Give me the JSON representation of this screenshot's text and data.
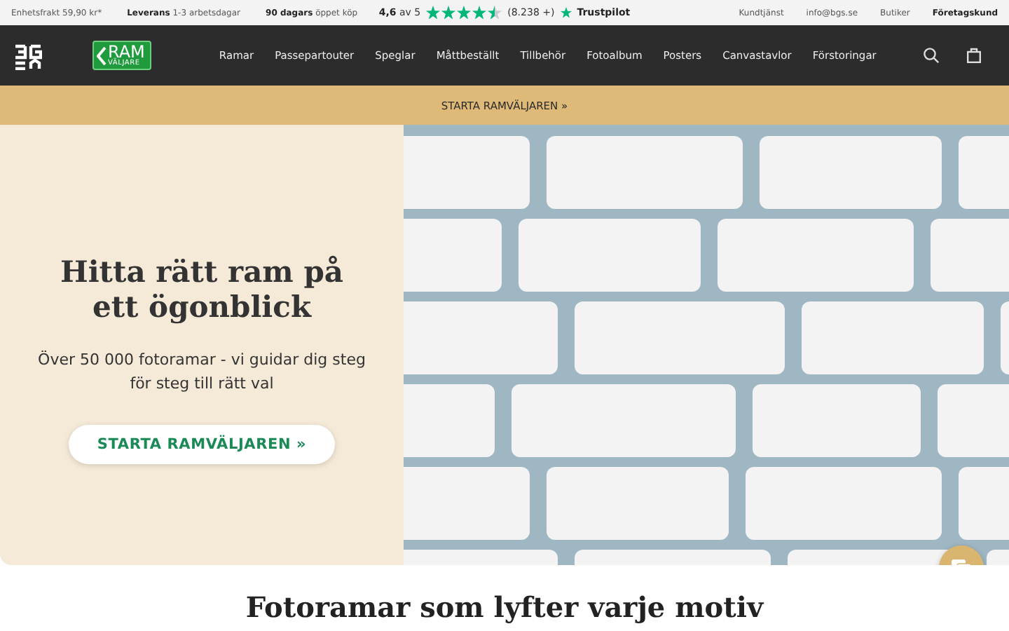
{
  "top_bar": {
    "left": [
      "Enhetsfrakt 59,90 kr*",
      "**Leverans** 1-3 arbetsdagar",
      "**90 dagars** öppet köp"
    ],
    "rating": {
      "score": "**4,6** av 5",
      "stars": 4.5,
      "count": "(8.238 +)",
      "brand": "Trustpilot"
    },
    "right": [
      {
        "label": "Kundtjänst",
        "bold": false
      },
      {
        "label": "info@bgs.se",
        "bold": false
      },
      {
        "label": "Butiker",
        "bold": false
      },
      {
        "label": "Företagskund",
        "bold": true
      }
    ]
  },
  "nav": {
    "badge": {
      "line1": "RAM",
      "line2": "VÄLJARE"
    },
    "items": [
      "Ramar",
      "Passepartouter",
      "Speglar",
      "Måttbeställt",
      "Tillbehör",
      "Fotoalbum",
      "Posters",
      "Canvastavlor",
      "Förstoringar"
    ]
  },
  "banner": {
    "label": "STARTA RAMVÄLJAREN »"
  },
  "hero": {
    "title": "Hitta rätt ram på ett ögonblick",
    "text": "Över 50 000 fotoramar - vi guidar dig steg för steg till rätt val",
    "button": "STARTA RAMVÄLJAREN »"
  },
  "section": {
    "heading": "Fotoramar som lyfter varje motiv"
  }
}
